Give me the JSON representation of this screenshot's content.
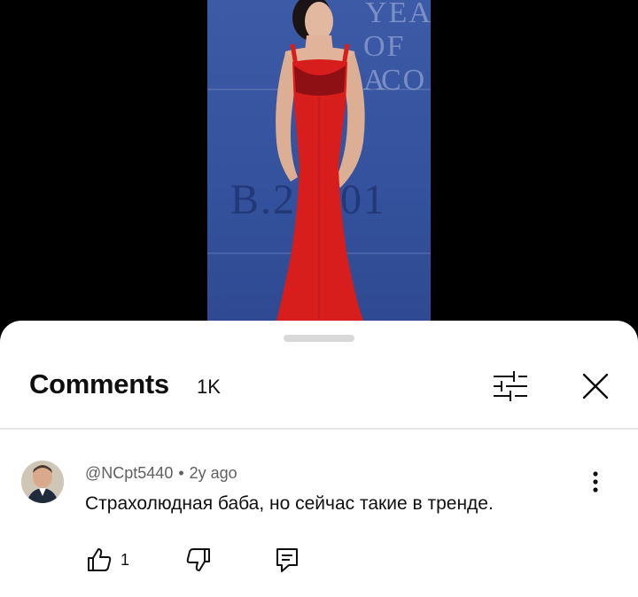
{
  "video": {
    "wall_text": [
      "YEA",
      "OF A",
      "CO",
      "B.2",
      "01"
    ]
  },
  "comments_panel": {
    "title": "Comments",
    "count": "1K"
  },
  "comment": {
    "author": "@NCpt5440",
    "separator": "•",
    "time": "2y ago",
    "text": "Страхолюдная баба, но сейчас такие в тренде.",
    "likes": "1"
  },
  "colors": {
    "wall_blue": "#3c5aa6",
    "dress_red": "#d81d1d",
    "text_primary": "#0f0f0f",
    "text_secondary": "#606060"
  },
  "icons": [
    "filter-icon",
    "close-icon",
    "more-vert-icon",
    "thumb-up-icon",
    "thumb-down-icon",
    "reply-icon"
  ]
}
